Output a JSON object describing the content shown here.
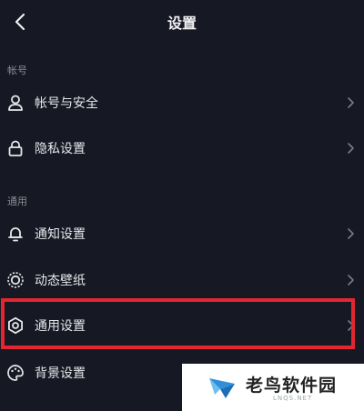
{
  "header": {
    "title": "设置"
  },
  "sections": {
    "account": {
      "label": "帐号",
      "items": [
        {
          "label": "帐号与安全",
          "icon": "user-icon"
        },
        {
          "label": "隐私设置",
          "icon": "lock-icon"
        }
      ]
    },
    "general": {
      "label": "通用",
      "items": [
        {
          "label": "通知设置",
          "icon": "bell-icon"
        },
        {
          "label": "动态壁纸",
          "icon": "live-wallpaper-icon"
        },
        {
          "label": "通用设置",
          "icon": "gear-icon"
        },
        {
          "label": "背景设置",
          "icon": "palette-icon"
        }
      ]
    }
  },
  "colors": {
    "background": "#161823",
    "text": "#e6e6ea",
    "section_text": "#8a8b92",
    "highlight": "#e3262f"
  },
  "watermark": {
    "text": "老鸟软件园",
    "sub": "LNQS.NET"
  }
}
